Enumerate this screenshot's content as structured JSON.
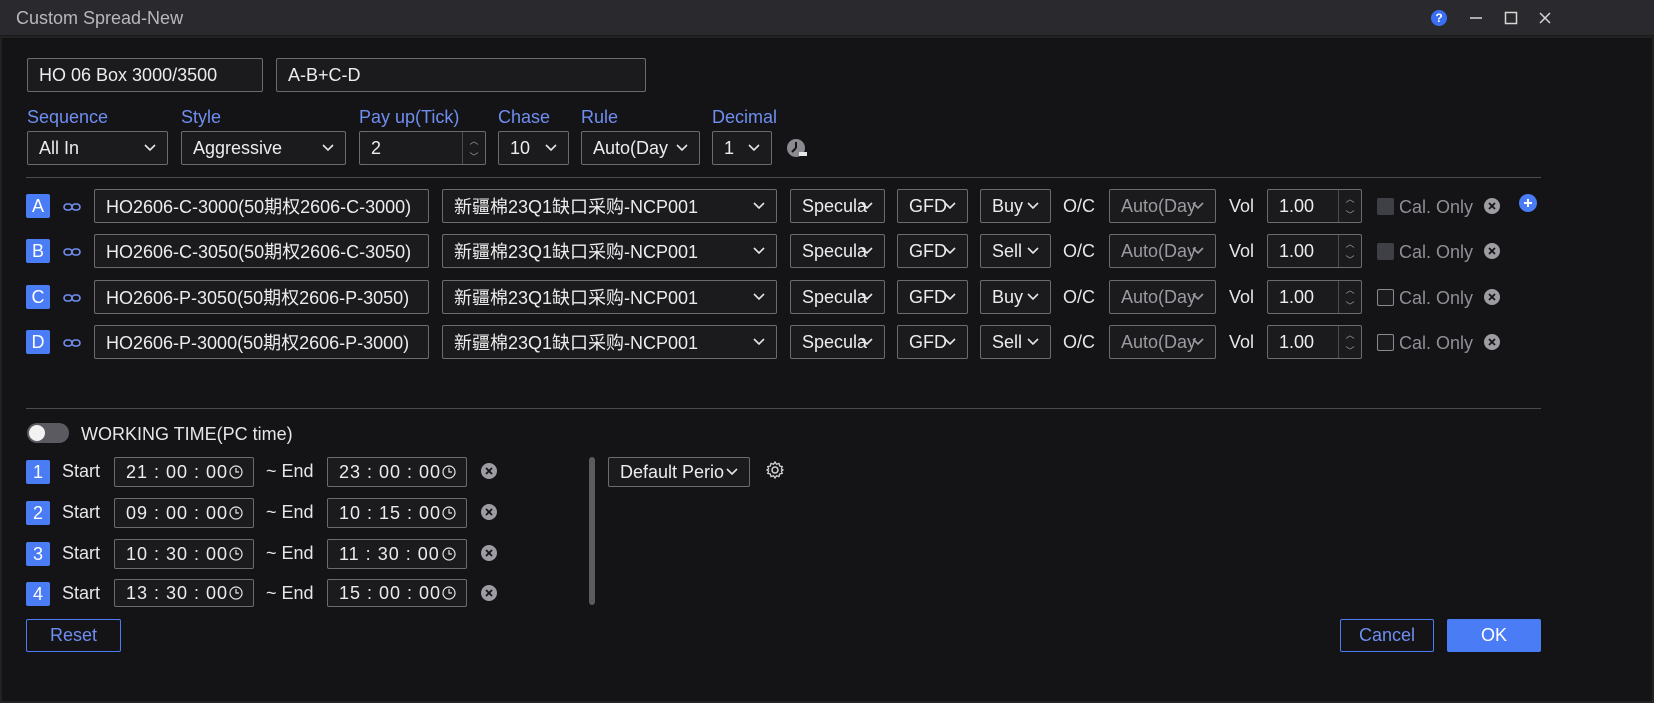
{
  "window": {
    "title": "Custom Spread-New",
    "help_icon": "?",
    "minimize_icon": "—",
    "maximize_icon": "☐",
    "close_icon": "✕"
  },
  "header": {
    "spread_name": "HO 06 Box 3000/3500",
    "formula": "A-B+C-D"
  },
  "settings": {
    "sequence_label": "Sequence",
    "sequence_value": "All In",
    "style_label": "Style",
    "style_value": "Aggressive",
    "payup_label": "Pay up(Tick)",
    "payup_value": "2",
    "chase_label": "Chase",
    "chase_value": "10",
    "rule_label": "Rule",
    "rule_value": "Auto(Day",
    "decimal_label": "Decimal",
    "decimal_value": "1"
  },
  "legs_labels": {
    "oc": "O/C",
    "vol": "Vol",
    "cal_only": "Cal. Only"
  },
  "legs": [
    {
      "id": "A",
      "contract": "HO2606-C-3000(50期权2606-C-3000)",
      "account": "新疆棉23Q1缺口采购-NCP001",
      "hedge": "Specula",
      "tif": "GFD",
      "side": "Buy",
      "oc": "Auto(Day",
      "vol": "1.00",
      "cal_checked": true
    },
    {
      "id": "B",
      "contract": "HO2606-C-3050(50期权2606-C-3050)",
      "account": "新疆棉23Q1缺口采购-NCP001",
      "hedge": "Specula",
      "tif": "GFD",
      "side": "Sell",
      "oc": "Auto(Day",
      "vol": "1.00",
      "cal_checked": true
    },
    {
      "id": "C",
      "contract": "HO2606-P-3050(50期权2606-P-3050)",
      "account": "新疆棉23Q1缺口采购-NCP001",
      "hedge": "Specula",
      "tif": "GFD",
      "side": "Buy",
      "oc": "Auto(Day",
      "vol": "1.00",
      "cal_checked": false
    },
    {
      "id": "D",
      "contract": "HO2606-P-3000(50期权2606-P-3000)",
      "account": "新疆棉23Q1缺口采购-NCP001",
      "hedge": "Specula",
      "tif": "GFD",
      "side": "Sell",
      "oc": "Auto(Day",
      "vol": "1.00",
      "cal_checked": false
    }
  ],
  "working_time": {
    "label": "WORKING TIME(PC time)",
    "enabled": false,
    "start_label": "Start",
    "end_label": "~ End",
    "period_value": "Default Perio",
    "periods": [
      {
        "n": "1",
        "start": "21 : 00 : 00",
        "end": "23 : 00 : 00"
      },
      {
        "n": "2",
        "start": "09 : 00 : 00",
        "end": "10 : 15 : 00"
      },
      {
        "n": "3",
        "start": "10 : 30 : 00",
        "end": "11 : 30 : 00"
      },
      {
        "n": "4",
        "start": "13 : 30 : 00",
        "end": "15 : 00 : 00"
      }
    ]
  },
  "footer": {
    "reset_label": "Reset",
    "cancel_label": "Cancel",
    "ok_label": "OK"
  },
  "colors": {
    "accent": "#4a7cf6",
    "label_blue": "#6f8ef0",
    "background": "#141417",
    "field_border": "#6a6a70"
  }
}
